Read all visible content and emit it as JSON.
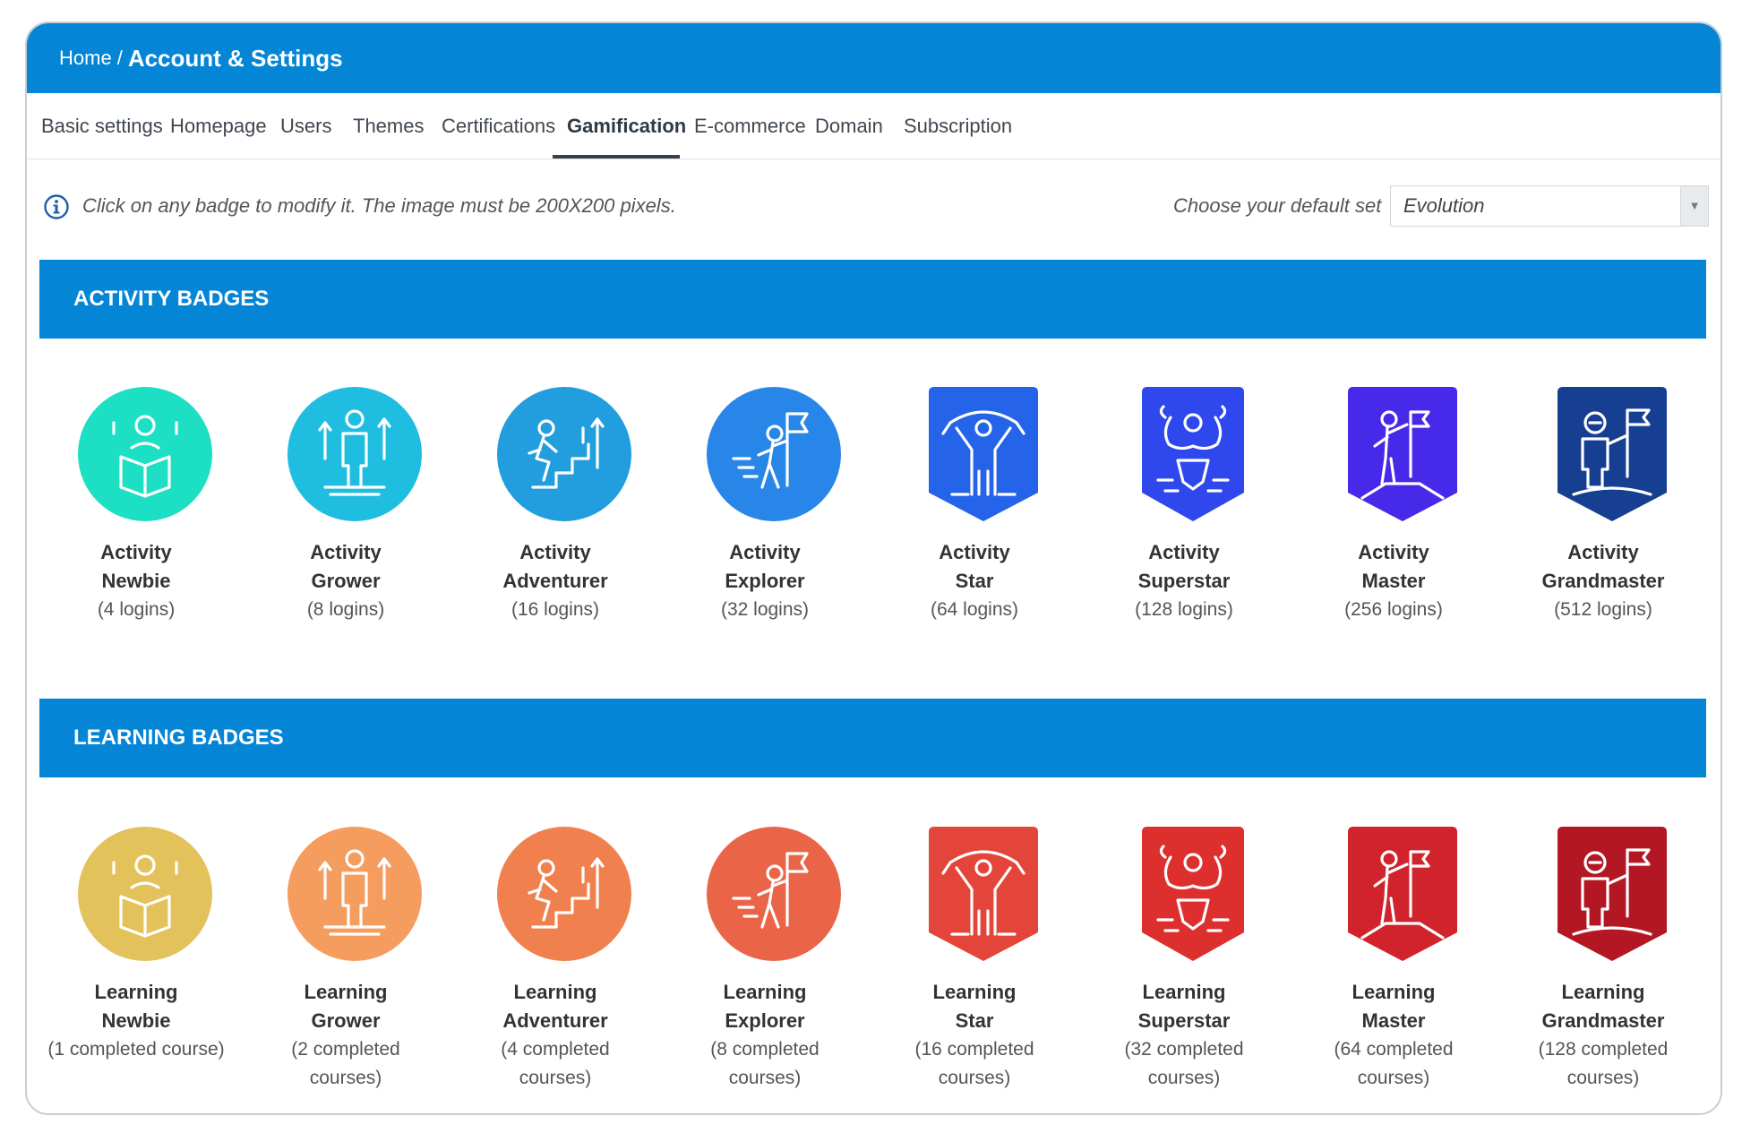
{
  "header": {
    "breadcrumb_home": "Home",
    "breadcrumb_sep": "/",
    "breadcrumb_current": "Account & Settings"
  },
  "tabs": [
    {
      "label": "Basic settings",
      "active": false
    },
    {
      "label": "Homepage",
      "active": false
    },
    {
      "label": "Users",
      "active": false
    },
    {
      "label": "Themes",
      "active": false
    },
    {
      "label": "Certifications",
      "active": false
    },
    {
      "label": "Gamification",
      "active": true
    },
    {
      "label": "E-commerce",
      "active": false
    },
    {
      "label": "Domain",
      "active": false
    },
    {
      "label": "Subscription",
      "active": false
    }
  ],
  "info": {
    "icon": "info-circle-icon",
    "text": "Click on any badge to modify it. The image must be 200X200 pixels."
  },
  "default_set": {
    "label": "Choose your default set",
    "value": "Evolution"
  },
  "colors": {
    "brand": "#0485d6",
    "activity": [
      "#1ddfc4",
      "#1fbde0",
      "#229dde",
      "#2886e8",
      "#2563e9",
      "#2f48ee",
      "#4629e9",
      "#173f91"
    ],
    "learning": [
      "#e3c25b",
      "#f59c5f",
      "#f0814e",
      "#ea6548",
      "#e3453a",
      "#de2f2f",
      "#d1232c",
      "#b31723"
    ]
  },
  "sections": [
    {
      "title": "ACTIVITY BADGES",
      "badges": [
        {
          "line1": "Activity",
          "line2": "Newbie",
          "req1": "(4 logins)",
          "req2": "",
          "icon": "reading-person-icon",
          "shape": "circle"
        },
        {
          "line1": "Activity",
          "line2": "Grower",
          "req1": "(8 logins)",
          "req2": "",
          "icon": "growing-person-icon",
          "shape": "circle"
        },
        {
          "line1": "Activity",
          "line2": "Adventurer",
          "req1": "(16 logins)",
          "req2": "",
          "icon": "climbing-stairs-icon",
          "shape": "circle"
        },
        {
          "line1": "Activity",
          "line2": "Explorer",
          "req1": "(32 logins)",
          "req2": "",
          "icon": "explorer-flag-icon",
          "shape": "circle"
        },
        {
          "line1": "Activity",
          "line2": "Star",
          "req1": "(64 logins)",
          "req2": "",
          "icon": "star-banner-icon",
          "shape": "shield"
        },
        {
          "line1": "Activity",
          "line2": "Superstar",
          "req1": "(128 logins)",
          "req2": "",
          "icon": "superhero-icon",
          "shape": "shield"
        },
        {
          "line1": "Activity",
          "line2": "Master",
          "req1": "(256 logins)",
          "req2": "",
          "icon": "summit-flag-icon",
          "shape": "shield"
        },
        {
          "line1": "Activity",
          "line2": "Grandmaster",
          "req1": "(512 logins)",
          "req2": "",
          "icon": "astronaut-flag-icon",
          "shape": "shield"
        }
      ]
    },
    {
      "title": "LEARNING BADGES",
      "badges": [
        {
          "line1": "Learning",
          "line2": "Newbie",
          "req1": "(1 completed course)",
          "req2": "",
          "icon": "reading-person-icon",
          "shape": "circle"
        },
        {
          "line1": "Learning",
          "line2": "Grower",
          "req1": "(2 completed",
          "req2": "courses)",
          "icon": "growing-person-icon",
          "shape": "circle"
        },
        {
          "line1": "Learning",
          "line2": "Adventurer",
          "req1": "(4 completed",
          "req2": "courses)",
          "icon": "climbing-stairs-icon",
          "shape": "circle"
        },
        {
          "line1": "Learning",
          "line2": "Explorer",
          "req1": "(8 completed",
          "req2": "courses)",
          "icon": "explorer-flag-icon",
          "shape": "circle"
        },
        {
          "line1": "Learning",
          "line2": "Star",
          "req1": "(16 completed",
          "req2": "courses)",
          "icon": "star-banner-icon",
          "shape": "shield"
        },
        {
          "line1": "Learning",
          "line2": "Superstar",
          "req1": "(32 completed",
          "req2": "courses)",
          "icon": "superhero-icon",
          "shape": "shield"
        },
        {
          "line1": "Learning",
          "line2": "Master",
          "req1": "(64 completed",
          "req2": "courses)",
          "icon": "summit-flag-icon",
          "shape": "shield"
        },
        {
          "line1": "Learning",
          "line2": "Grandmaster",
          "req1": "(128 completed",
          "req2": "courses)",
          "icon": "astronaut-flag-icon",
          "shape": "shield"
        }
      ]
    }
  ]
}
